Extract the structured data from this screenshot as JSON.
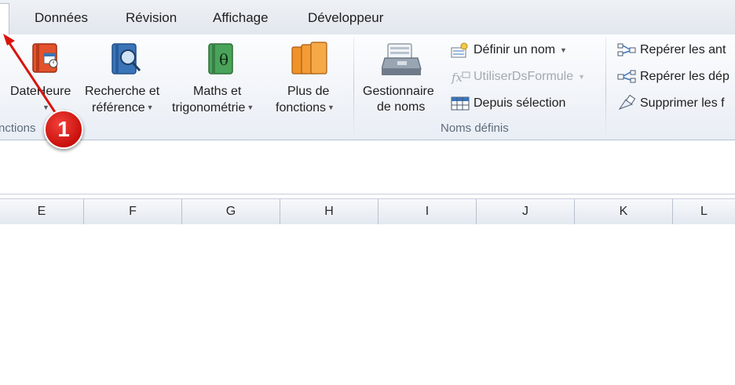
{
  "tabs": [
    "Données",
    "Révision",
    "Affichage",
    "Développeur"
  ],
  "ribbon": {
    "fonctions_group": {
      "label_partial": "nctions",
      "buttons": [
        {
          "label": "DateHeure",
          "icon": "calendar-book-icon",
          "color": "#e2532d"
        },
        {
          "label_line1": "Recherche et",
          "label_line2": "référence",
          "icon": "search-book-icon",
          "color": "#3a74b8"
        },
        {
          "label_line1": "Maths et",
          "label_line2": "trigonométrie",
          "icon": "theta-book-icon",
          "color": "#4aa35a"
        },
        {
          "label_line1": "Plus de",
          "label_line2": "fonctions",
          "icon": "more-books-icon",
          "color": "#f0922a"
        }
      ]
    },
    "noms_group": {
      "label": "Noms définis",
      "manager": {
        "label_line1": "Gestionnaire",
        "label_line2": "de noms",
        "icon": "name-manager-icon"
      },
      "small": [
        {
          "label": "Définir un nom",
          "icon": "define-name-icon",
          "enabled": true
        },
        {
          "label": "UtiliserDsFormule",
          "icon": "use-in-formula-icon",
          "enabled": false
        },
        {
          "label": "Depuis sélection",
          "icon": "create-from-selection-icon",
          "enabled": true
        }
      ]
    },
    "audit_group": {
      "small": [
        {
          "label": "Repérer les ant",
          "icon": "trace-precedents-icon"
        },
        {
          "label": "Repérer les dép",
          "icon": "trace-dependents-icon"
        },
        {
          "label": "Supprimer les f",
          "icon": "remove-arrows-icon"
        }
      ]
    }
  },
  "columns": [
    "E",
    "F",
    "G",
    "H",
    "I",
    "J",
    "K",
    "L"
  ],
  "annotation": {
    "number": "1",
    "color": "#d9140e"
  }
}
